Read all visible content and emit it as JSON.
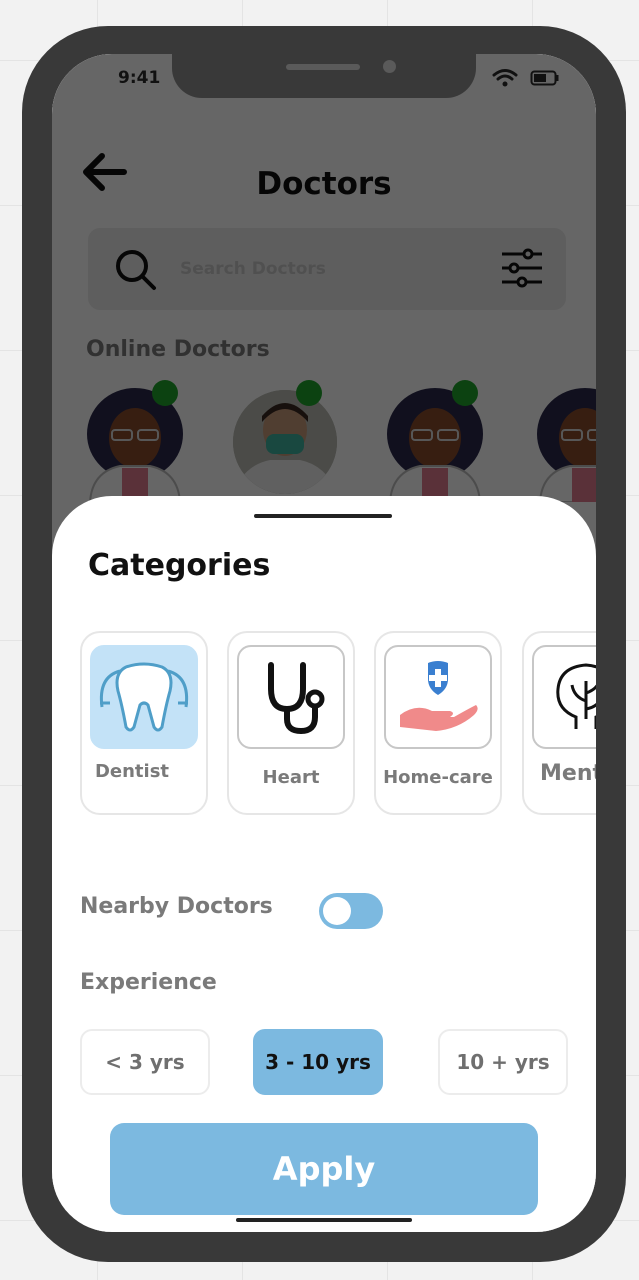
{
  "status_bar": {
    "time": "9:41"
  },
  "header": {
    "title": "Doctors"
  },
  "search": {
    "placeholder": "Search Doctors"
  },
  "online": {
    "title": "Online Doctors",
    "doctors": [
      {
        "avatar": "female-doctor-avatar",
        "online": true
      },
      {
        "avatar": "male-doctor-photo",
        "online": true
      },
      {
        "avatar": "female-doctor-avatar",
        "online": true
      },
      {
        "avatar": "female-doctor-avatar",
        "online": false
      }
    ]
  },
  "sheet": {
    "categories_title": "Categories",
    "categories": [
      {
        "label": "Dentist",
        "icon": "tooth-icon",
        "selected": true
      },
      {
        "label": "Heart",
        "icon": "stethoscope-icon",
        "selected": false
      },
      {
        "label": "Home-care",
        "icon": "home-care-icon",
        "selected": false
      },
      {
        "label": "Mental",
        "icon": "brain-icon",
        "selected": false
      }
    ],
    "nearby": {
      "label": "Nearby Doctors",
      "enabled": true
    },
    "experience": {
      "label": "Experience",
      "options": [
        "< 3 yrs",
        "3 - 10 yrs",
        "10 + yrs"
      ],
      "selected": "3 - 10 yrs"
    },
    "apply_label": "Apply"
  },
  "colors": {
    "accent": "#7cb9e0",
    "selected_category_bg": "#c3e2f7",
    "online_dot": "#1fa52c",
    "phone_frame": "#393939"
  }
}
